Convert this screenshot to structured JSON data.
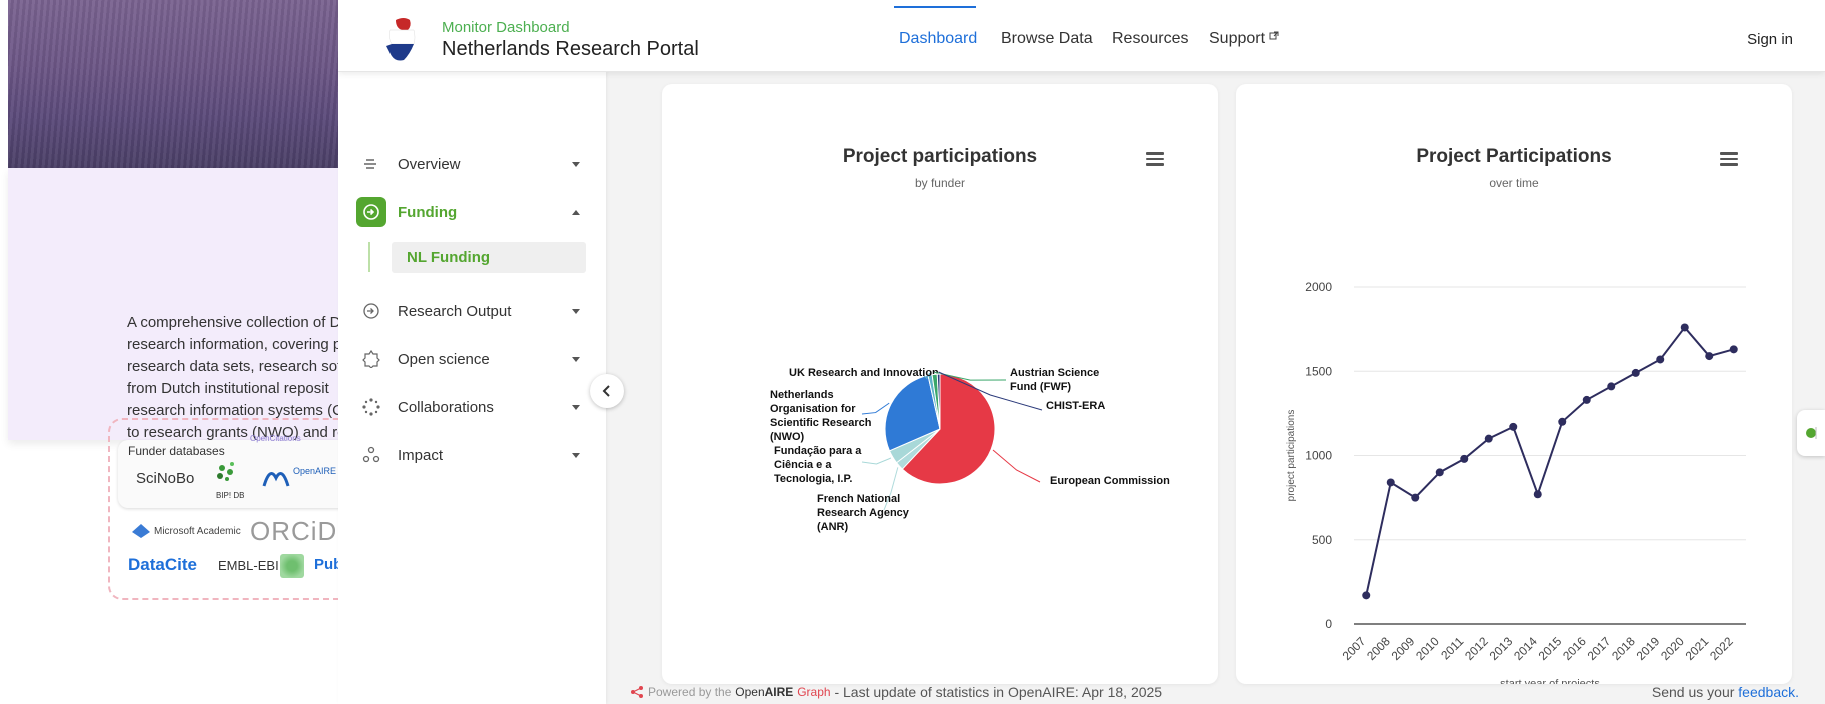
{
  "background": {
    "description_lines": [
      "A comprehensive collection of D",
      "research information, covering  p",
      "research data sets, research soft",
      "from  Dutch institutional reposit",
      "research information systems (C",
      "to research grants (NWO) and re"
    ],
    "funder_databases_label": "Funder databases",
    "logos": [
      "SciNoBo",
      "BIP! DB",
      "OpenAIRE UsageCounts",
      "OpenCitations",
      "Microsoft Academic",
      "ORCiD",
      "DataCite",
      "EMBL-EBI",
      "Pub"
    ]
  },
  "header": {
    "brand_sub": "Monitor Dashboard",
    "brand_title": "Netherlands Research Portal",
    "nav": [
      "Dashboard",
      "Browse Data",
      "Resources",
      "Support"
    ],
    "active_nav": "Dashboard",
    "sign_in": "Sign in"
  },
  "sidebar": {
    "items": [
      {
        "label": "Overview",
        "icon": "lines-icon",
        "expanded": false
      },
      {
        "label": "Funding",
        "icon": "funding-icon",
        "expanded": true
      },
      {
        "label": "Research Output",
        "icon": "research-output-icon",
        "expanded": false
      },
      {
        "label": "Open science",
        "icon": "open-science-icon",
        "expanded": false
      },
      {
        "label": "Collaborations",
        "icon": "collaborations-icon",
        "expanded": false
      },
      {
        "label": "Impact",
        "icon": "impact-icon",
        "expanded": false
      }
    ],
    "sub_item": "NL Funding"
  },
  "cards": {
    "pie": {
      "title": "Project participations",
      "subtitle": "by funder"
    },
    "line": {
      "title": "Project Participations",
      "subtitle": "over time"
    }
  },
  "chart_data": [
    {
      "type": "pie",
      "title": "Project participations",
      "subtitle": "by funder",
      "slices": [
        {
          "name": "European Commission",
          "value": 62,
          "color": "#e63946"
        },
        {
          "name": "French National Research Agency (ANR)",
          "value": 2.5,
          "color": "#b0dbdc"
        },
        {
          "name": "Fundação para a Ciência e a Tecnologia, I.P.",
          "value": 4,
          "color": "#a8d8d8"
        },
        {
          "name": "Netherlands Organisation for Scientific Research (NWO)",
          "value": 28,
          "color": "#2f7ad6"
        },
        {
          "name": "UK Research and Innovation",
          "value": 1.2,
          "color": "#5fb3c7"
        },
        {
          "name": "Austrian Science Fund (FWF)",
          "value": 1.5,
          "color": "#3aa66a"
        },
        {
          "name": "CHIST-ERA",
          "value": 0.8,
          "color": "#2b3a7a"
        }
      ]
    },
    {
      "type": "line",
      "title": "Project Participations",
      "subtitle": "over time",
      "xlabel": "start year of projects",
      "ylabel": "project participations",
      "ylim": [
        0,
        2000
      ],
      "yticks": [
        0,
        500,
        1000,
        1500,
        2000
      ],
      "x": [
        "2007",
        "2008",
        "2009",
        "2010",
        "2011",
        "2012",
        "2013",
        "2014",
        "2015",
        "2016",
        "2017",
        "2018",
        "2019",
        "2020",
        "2021",
        "2022"
      ],
      "values": [
        170,
        840,
        750,
        900,
        980,
        1100,
        1170,
        770,
        1200,
        1330,
        1410,
        1490,
        1570,
        1760,
        1590,
        1630
      ],
      "color": "#2e2d5e"
    }
  ],
  "footer": {
    "powered_by": "Powered by the",
    "openaire_open": "Open",
    "openaire_aire": "AIRE",
    "graph": "Graph",
    "last_update": "- Last update of statistics in OpenAIRE: Apr 18, 2025",
    "send": "Send us your",
    "feedback": "feedback."
  }
}
